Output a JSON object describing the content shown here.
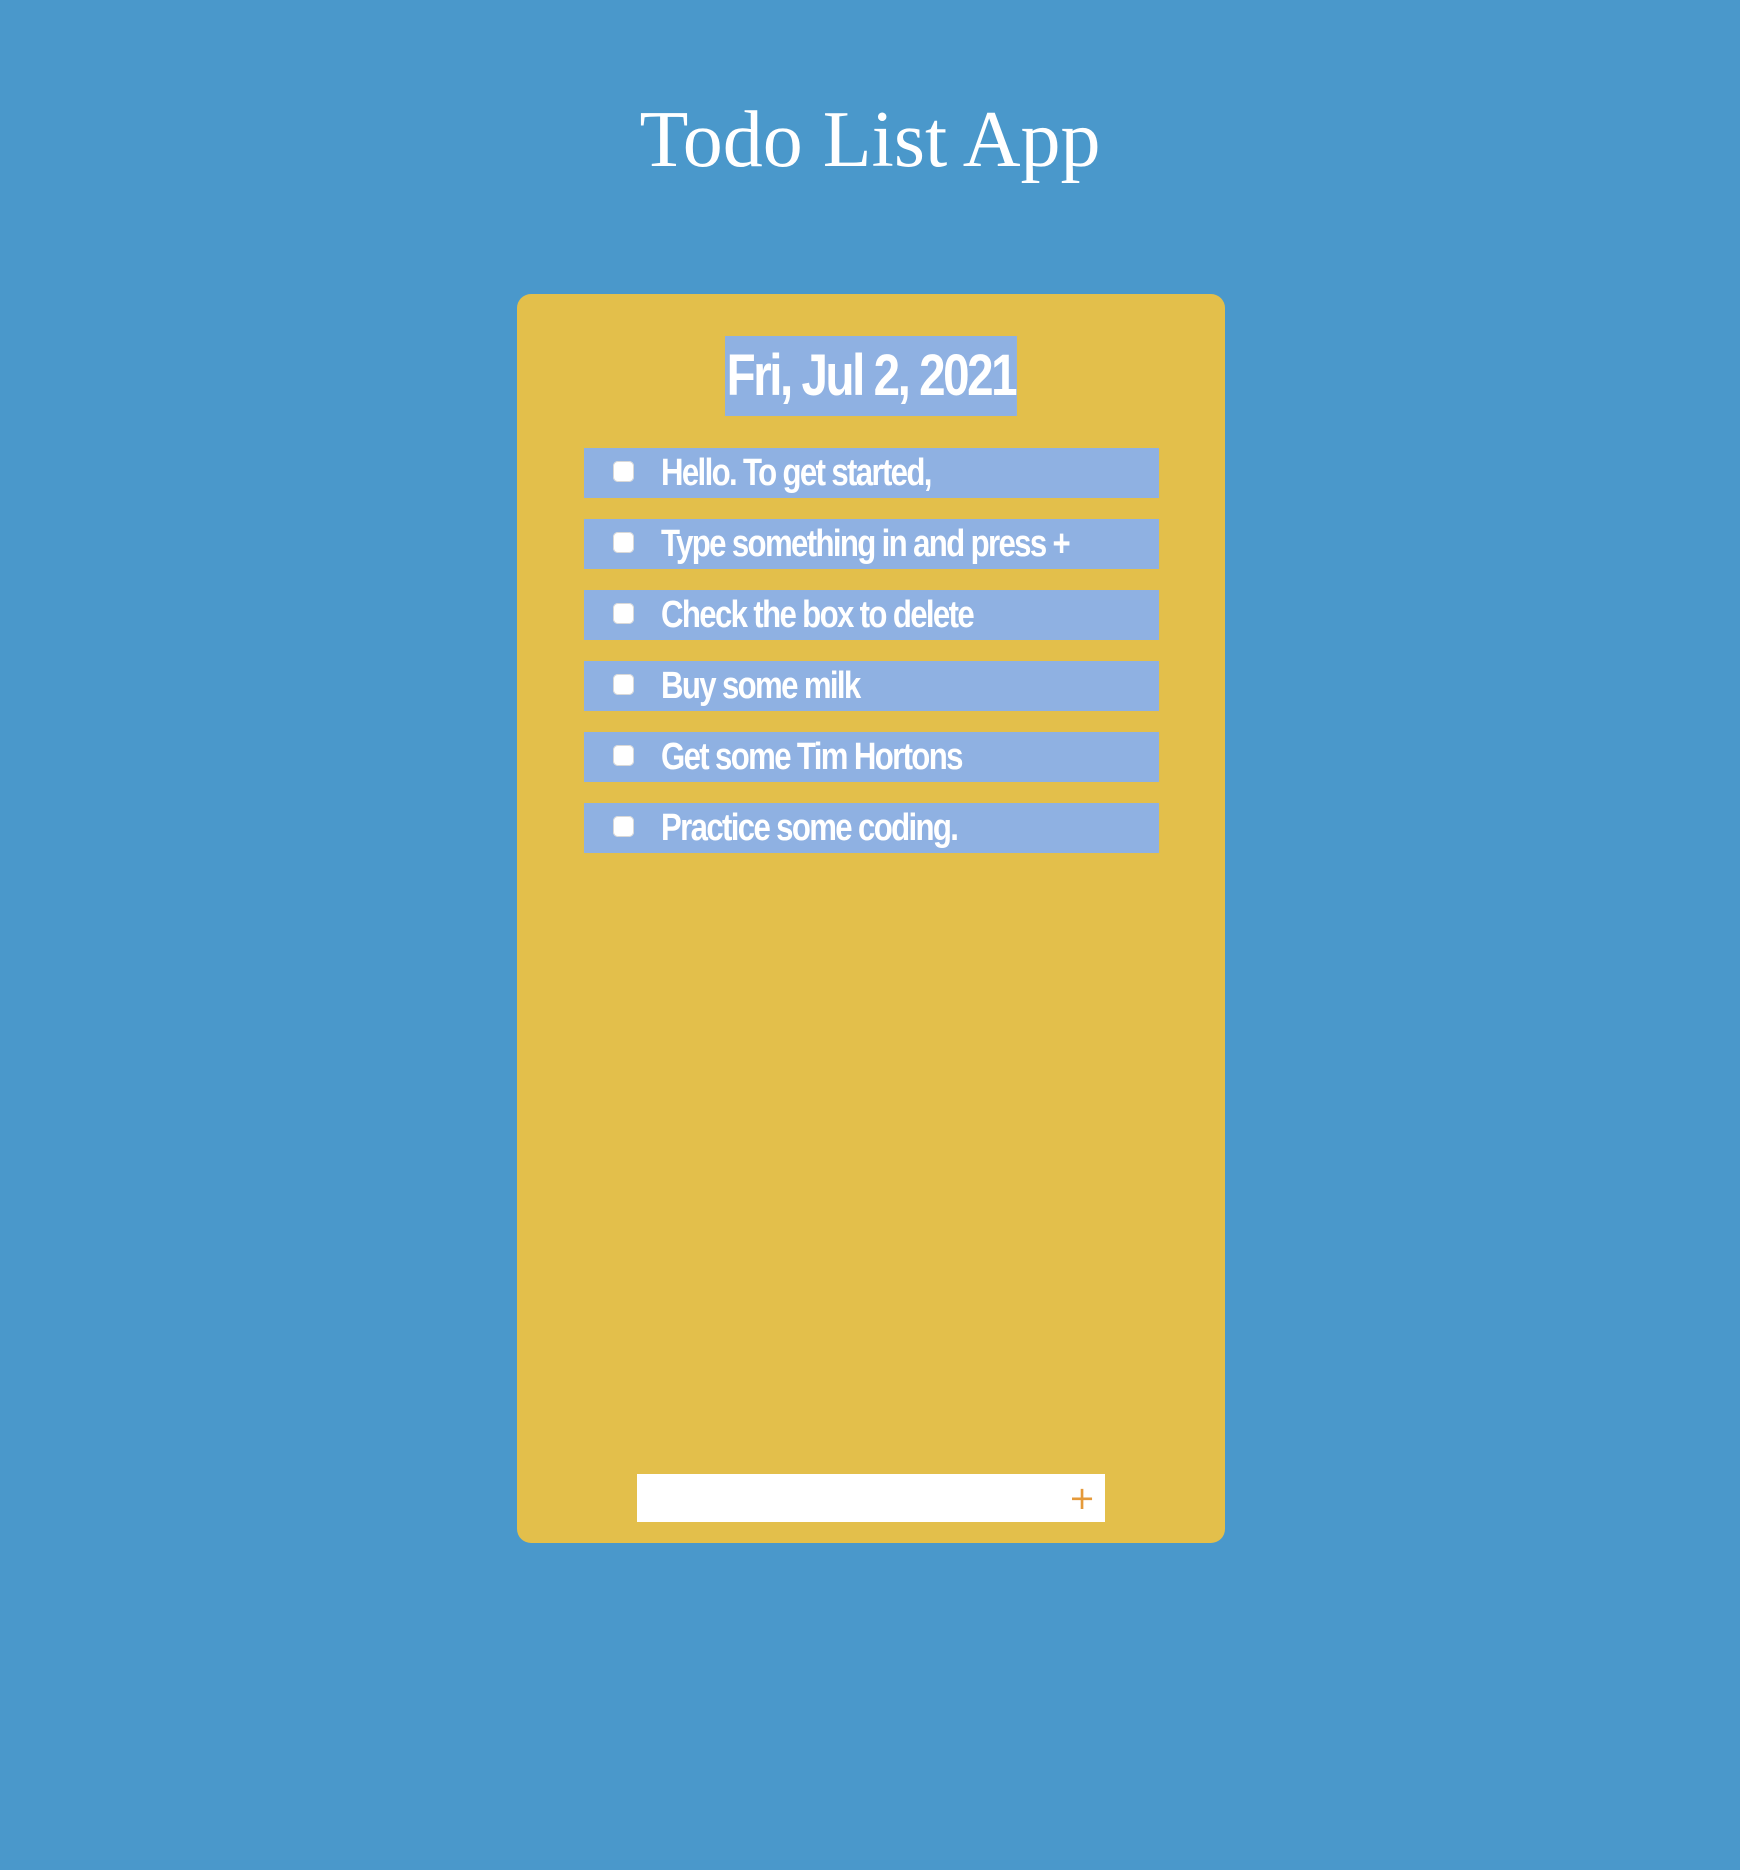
{
  "app": {
    "title": "Todo List App"
  },
  "card": {
    "date": "Fri, Jul 2, 2021"
  },
  "todos": [
    {
      "text": "Hello. To get started,",
      "checked": false
    },
    {
      "text": "Type something in and press +",
      "checked": false
    },
    {
      "text": "Check the box to delete",
      "checked": false
    },
    {
      "text": "Buy some milk",
      "checked": false
    },
    {
      "text": "Get some Tim Hortons",
      "checked": false
    },
    {
      "text": "Practice some coding.",
      "checked": false
    }
  ],
  "add_form": {
    "input_value": "",
    "button_label": "+"
  },
  "colors": {
    "background": "#4a98cb",
    "card": "#e3bf4b",
    "highlight": "#8fb1e2",
    "add_button": "#e59a3a",
    "text": "#ffffff"
  }
}
